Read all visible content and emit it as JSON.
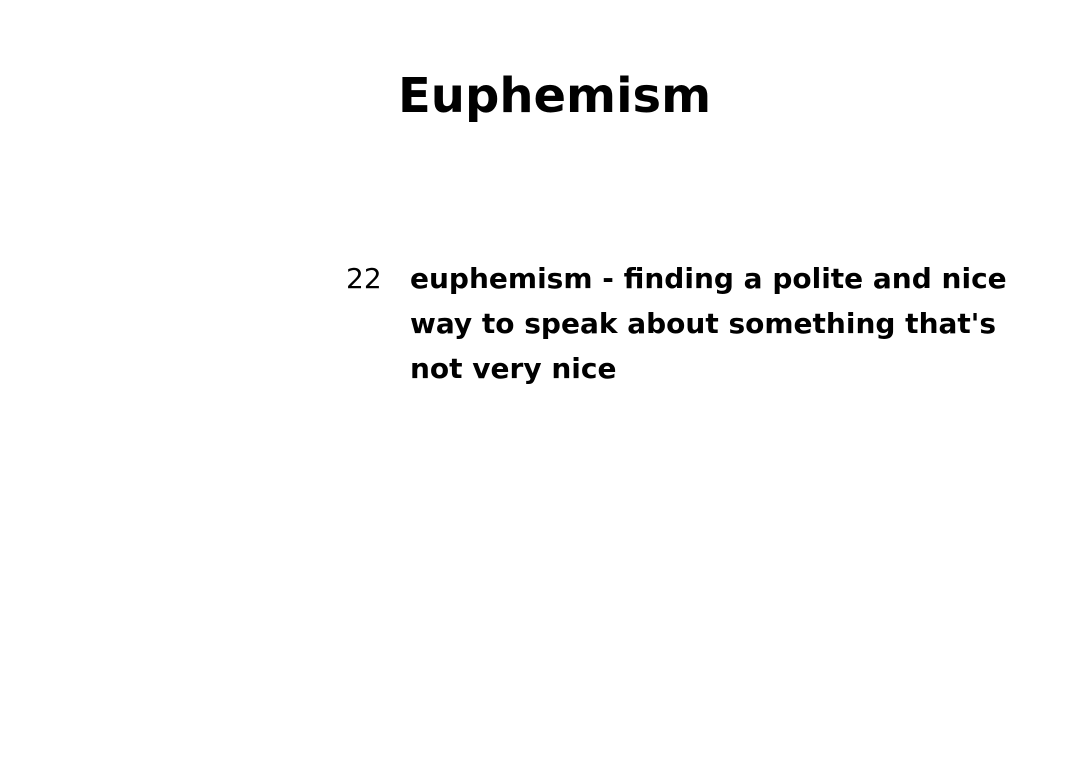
{
  "slide": {
    "title": "Euphemism",
    "entry": {
      "number": "22",
      "text": "euphemism - finding a polite and nice way to speak about something that's not very nice"
    }
  }
}
